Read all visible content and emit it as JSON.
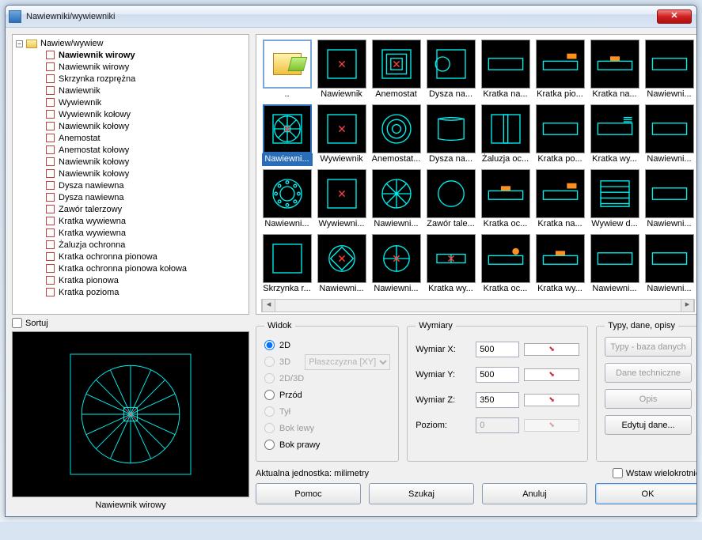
{
  "window": {
    "title": "Nawiewniki/wywiewniki"
  },
  "tree": {
    "root": "Nawiew/wywiew",
    "items": [
      {
        "label": "Nawiewnik wirowy",
        "selected": true
      },
      {
        "label": "Nawiewnik wirowy"
      },
      {
        "label": "Skrzynka rozprężna"
      },
      {
        "label": "Nawiewnik"
      },
      {
        "label": "Wywiewnik"
      },
      {
        "label": "Wywiewnik kołowy"
      },
      {
        "label": "Nawiewnik kołowy"
      },
      {
        "label": "Anemostat"
      },
      {
        "label": "Anemostat kołowy"
      },
      {
        "label": "Nawiewnik kołowy"
      },
      {
        "label": "Nawiewnik kołowy"
      },
      {
        "label": "Dysza nawiewna"
      },
      {
        "label": "Dysza nawiewna"
      },
      {
        "label": "Zawór talerzowy"
      },
      {
        "label": "Kratka wywiewna"
      },
      {
        "label": "Kratka wywiewna"
      },
      {
        "label": "Żaluzja ochronna"
      },
      {
        "label": "Kratka ochronna pionowa"
      },
      {
        "label": "Kratka ochronna pionowa kołowa"
      },
      {
        "label": "Kratka pionowa"
      },
      {
        "label": "Kratka pozioma"
      }
    ]
  },
  "sort_label": "Sortuj",
  "preview_label": "Nawiewnik wirowy",
  "thumbnails": [
    {
      "label": "..",
      "kind": "parent"
    },
    {
      "label": "Nawiewnik",
      "kind": "sq-x"
    },
    {
      "label": "Anemostat",
      "kind": "sq-conc"
    },
    {
      "label": "Dysza na...",
      "kind": "sq-circ-left"
    },
    {
      "label": "Kratka na...",
      "kind": "rect"
    },
    {
      "label": "Kratka pio...",
      "kind": "rect-or-top"
    },
    {
      "label": "Kratka na...",
      "kind": "rect-or-mid"
    },
    {
      "label": "Nawiewni...",
      "kind": "rect"
    },
    {
      "label": "Nawiewni...",
      "kind": "wirowy",
      "selected": true
    },
    {
      "label": "Wywiewnik",
      "kind": "sq-x"
    },
    {
      "label": "Anemostat...",
      "kind": "circ-conc"
    },
    {
      "label": "Dysza na...",
      "kind": "barrel"
    },
    {
      "label": "Żaluzja oc...",
      "kind": "sq-vbar"
    },
    {
      "label": "Kratka po...",
      "kind": "rect"
    },
    {
      "label": "Kratka wy...",
      "kind": "rect-hatch-or"
    },
    {
      "label": "Nawiewni...",
      "kind": "rect"
    },
    {
      "label": "Nawiewni...",
      "kind": "circ-dots"
    },
    {
      "label": "Wywiewni...",
      "kind": "sq-x"
    },
    {
      "label": "Nawiewni...",
      "kind": "circ-spoke"
    },
    {
      "label": "Zawór tale...",
      "kind": "circ-plain"
    },
    {
      "label": "Kratka oc...",
      "kind": "rect-or-mid"
    },
    {
      "label": "Kratka na...",
      "kind": "rect-or-top"
    },
    {
      "label": "Wywiew d...",
      "kind": "rect-lines"
    },
    {
      "label": "Nawiewni...",
      "kind": "rect"
    },
    {
      "label": "Skrzynka r...",
      "kind": "sq-plain"
    },
    {
      "label": "Nawiewni...",
      "kind": "circ-diamond"
    },
    {
      "label": "Nawiewni...",
      "kind": "circ-plus"
    },
    {
      "label": "Kratka wy...",
      "kind": "flag"
    },
    {
      "label": "Kratka oc...",
      "kind": "rect-or-dot"
    },
    {
      "label": "Kratka wy...",
      "kind": "rect-or-mid"
    },
    {
      "label": "Nawiewni...",
      "kind": "rect"
    },
    {
      "label": "Nawiewni...",
      "kind": "rect"
    }
  ],
  "widok": {
    "legend": "Widok",
    "r2d": "2D",
    "r3d": "3D",
    "plane": "Płaszczyzna  [XY]",
    "r2d3d": "2D/3D",
    "front": "Przód",
    "back": "Tył",
    "left": "Bok lewy",
    "right": "Bok prawy"
  },
  "wymiary": {
    "legend": "Wymiary",
    "x_label": "Wymiar X:",
    "x_value": "500",
    "y_label": "Wymiar Y:",
    "y_value": "500",
    "z_label": "Wymiar Z:",
    "z_value": "350",
    "level_label": "Poziom:",
    "level_value": "0"
  },
  "typy": {
    "legend": "Typy, dane, opisy",
    "db": "Typy - baza danych",
    "tech": "Dane techniczne",
    "desc": "Opis",
    "edit": "Edytuj dane..."
  },
  "unit_label": "Aktualna jednostka: milimetry",
  "multi_insert": "Wstaw wielokrotnie",
  "buttons": {
    "help": "Pomoc",
    "search": "Szukaj",
    "cancel": "Anuluj",
    "ok": "OK"
  }
}
